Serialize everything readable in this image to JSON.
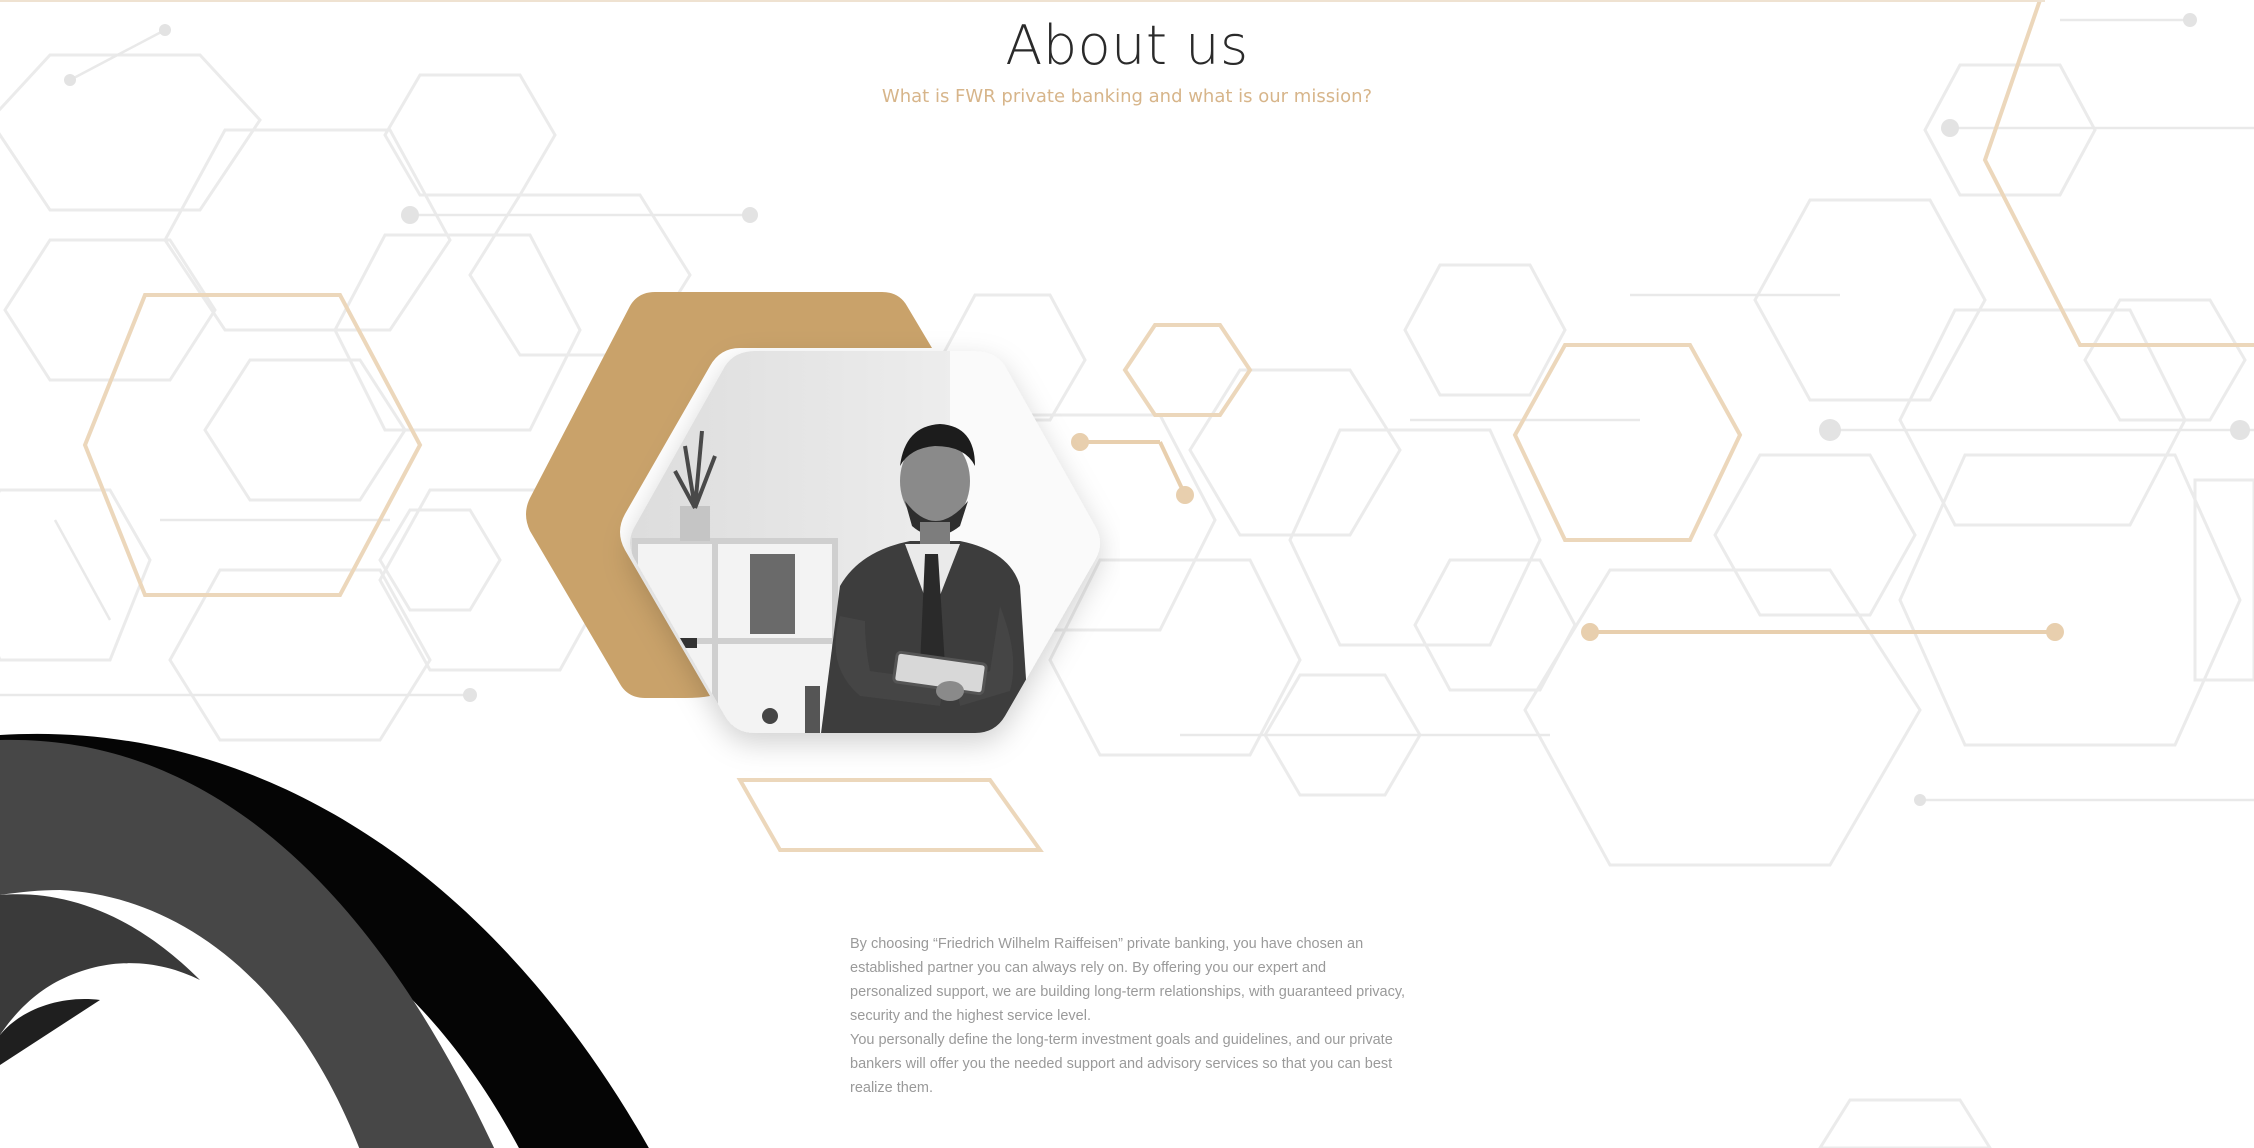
{
  "header": {
    "title": "About us",
    "subtitle": "What is FWR private banking and what is our mission?"
  },
  "content": {
    "paragraph_1": "By choosing “Friedrich Wilhelm Raiffeisen” private banking, you have chosen an established partner you can always rely on. By offering you our expert and personalized support, we are building long-term relationships, with guaranteed privacy, security and the highest service level.",
    "paragraph_2": "You personally define the long-term investment goals and guidelines, and our private bankers will offer you the needed support and advisory services so that you can best realize them."
  },
  "colors": {
    "accent": "#c9a26a",
    "accent_light": "#e8d2b4",
    "hex_line": "#e6e6e6",
    "text": "#9a9a9a",
    "title": "#2a2a2a"
  },
  "icons": {
    "photo": "businessman-with-tablet-photo",
    "background": "hexagon-network-pattern"
  }
}
